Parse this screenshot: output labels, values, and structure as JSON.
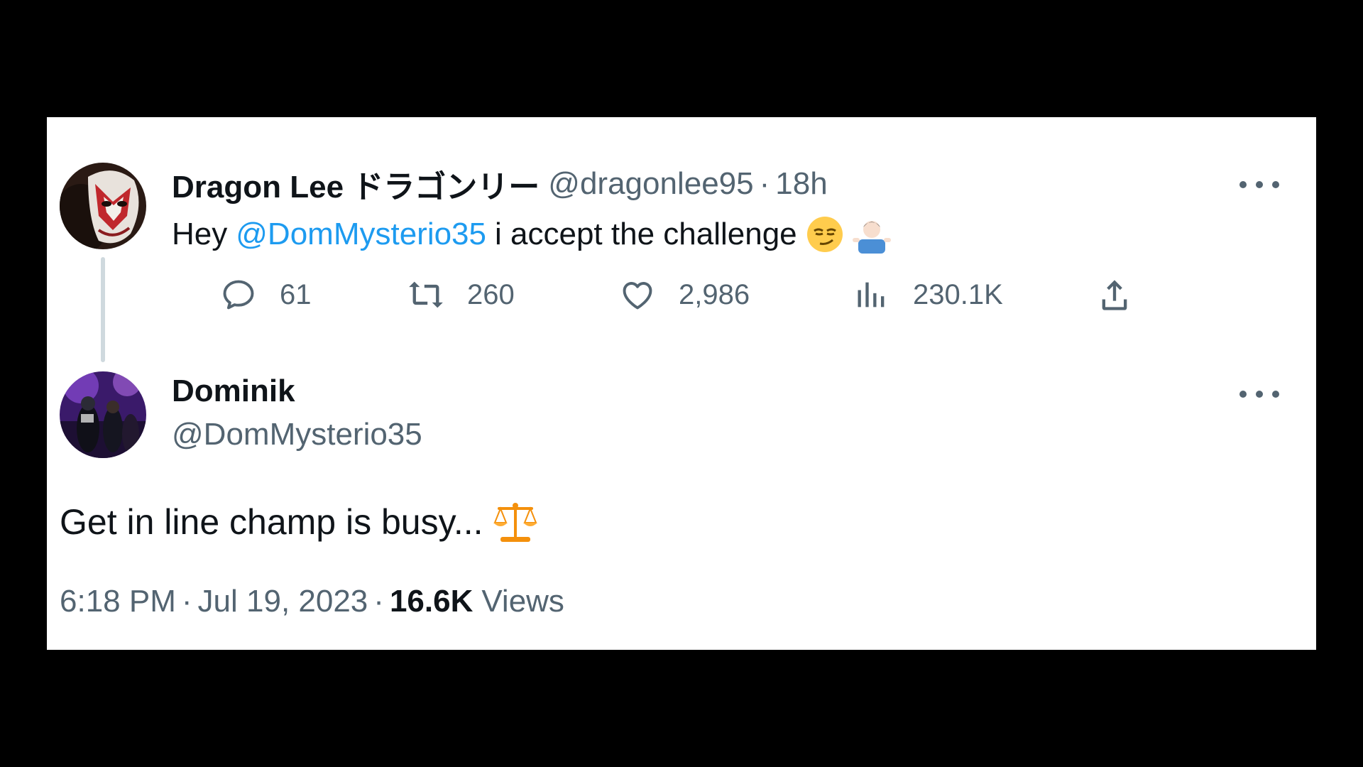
{
  "tweet1": {
    "display_name": "Dragon Lee ドラゴンリー",
    "handle": "@dragonlee95",
    "separator": "·",
    "time_ago": "18h",
    "text_prefix": "Hey",
    "mention": "@DomMysterio35",
    "text_suffix": "i accept the challenge",
    "emojis": [
      "smirking-face-emoji",
      "man-shrugging-emoji"
    ],
    "actions": {
      "replies": "61",
      "retweets": "260",
      "likes": "2,986",
      "views": "230.1K"
    }
  },
  "tweet2": {
    "display_name": "Dominik",
    "handle": "@DomMysterio35",
    "text": "Get in line champ is busy...",
    "emoji": "balance-scale-emoji",
    "time": "6:18 PM",
    "separator": "·",
    "date": "Jul 19, 2023",
    "views_count": "16.6K",
    "views_label": "Views"
  },
  "colors": {
    "background": "#000000",
    "card": "#ffffff",
    "text": "#0f1419",
    "muted": "#536471",
    "link": "#1d9bf0",
    "thread_line": "#cfd9de"
  }
}
